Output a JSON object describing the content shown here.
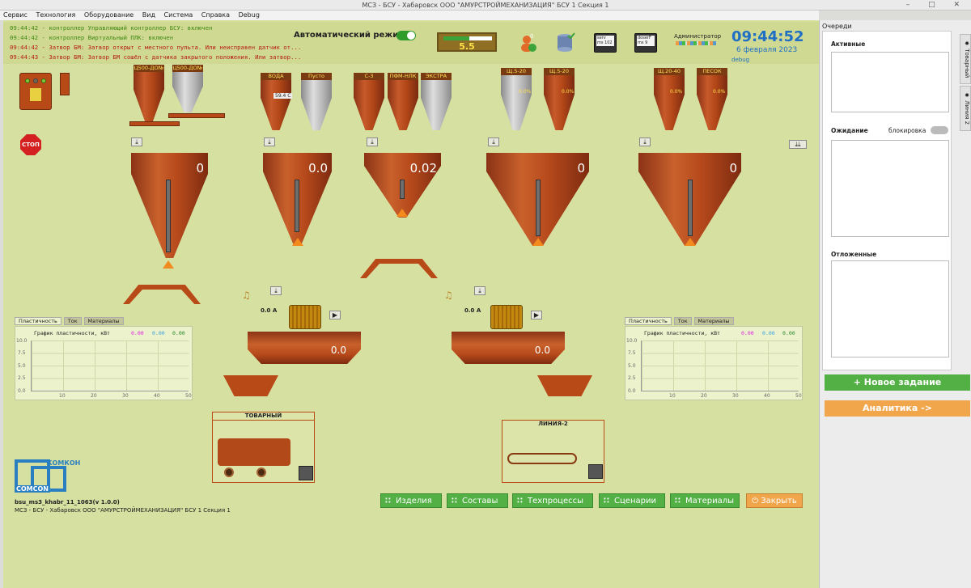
{
  "window": {
    "title": "МСЗ - БСУ - Хабаровск ООО \"АМУРСТРОЙМЕХАНИЗАЦИЯ\" БСУ 1 Секция 1",
    "controls": "–  □  ✕"
  },
  "menu": [
    "Сервис",
    "Технология",
    "Оборудование",
    "Вид",
    "Система",
    "Справка",
    "Debug"
  ],
  "log": [
    {
      "text": "09:44:42 - контроллер Управляющий контроллер БСУ: включен",
      "color": "green"
    },
    {
      "text": "09:44:42 - контроллер Виртуальный ПЛК: включен",
      "color": "green"
    },
    {
      "text": "09:44:42 - Затвор БМ: Затвор открыт с местного пульта. Или неисправен датчик от...",
      "color": "red"
    },
    {
      "text": "09:44:43 - Затвор БМ: Затвор БМ сошёл с датчика закрытого положения. Или затвор...",
      "color": "red"
    }
  ],
  "header": {
    "auto_mode_label": "Автоматический режим",
    "auto_mode_on": true,
    "gauge_value": "5.5",
    "gauge_fill": 0.53,
    "notif_count": "0",
    "serv_label": "serv",
    "serv_ms": "ms 102",
    "doser_label": "doserF",
    "doser_ms": "ms 9",
    "admin_label": "Администратор",
    "time": "09:44:52",
    "date": "6 февраля 2023",
    "debug": "debug"
  },
  "colors": {
    "accent": "#1f6fc4",
    "green_button": "#52b044",
    "orange_button": "#f1a64c",
    "copper": "#b74a1c",
    "background": "#d6e0a1"
  },
  "silos": [
    {
      "label": "Ц500-ДО№",
      "value": ""
    },
    {
      "label": "Ц500-ДО№",
      "value": ""
    },
    {
      "label": "ВОДА",
      "value": "59.4 C"
    },
    {
      "label": "Пусто",
      "value": ""
    },
    {
      "label": "С-3",
      "value": ""
    },
    {
      "label": "ПФМ-НЛК",
      "value": ""
    },
    {
      "label": "ЭКСТРА",
      "value": ""
    },
    {
      "label": "Щ.5-20",
      "value": "0.0%"
    },
    {
      "label": "Щ.5-20",
      "value": "0.0%"
    },
    {
      "label": "Щ.20-40",
      "value": "0.0%"
    },
    {
      "label": "ПЕСОК",
      "value": "0.0%"
    }
  ],
  "dosers": [
    "0",
    "0.0",
    "0.02",
    "0",
    "0"
  ],
  "stop_label": "СТОП",
  "mixers": [
    {
      "current": "0.0 A",
      "value": "0.0"
    },
    {
      "current": "0.0 A",
      "value": "0.0"
    }
  ],
  "charts": [
    {
      "tabs": [
        "Пластичность",
        "Ток",
        "Материалы"
      ],
      "title": "График пластичности, кВт",
      "readings": [
        "0.00",
        "0.00",
        "0.00"
      ],
      "reading_colors": [
        "#e020e0",
        "#3aa0e0",
        "#2a8a2a"
      ],
      "yticks": [
        "10.0",
        "7.5",
        "5.0",
        "2.5",
        "0.0"
      ],
      "xticks": [
        "10",
        "20",
        "30",
        "40",
        "50"
      ]
    },
    {
      "tabs": [
        "Пластичность",
        "Ток",
        "Материалы"
      ],
      "title": "График пластичности, кВт",
      "readings": [
        "0.00",
        "0.00",
        "0.00"
      ],
      "reading_colors": [
        "#e020e0",
        "#3aa0e0",
        "#2a8a2a"
      ],
      "yticks": [
        "10.0",
        "7.5",
        "5.0",
        "2.5",
        "0.0"
      ],
      "xticks": [
        "10",
        "20",
        "30",
        "40",
        "50"
      ]
    }
  ],
  "lines": [
    {
      "label": "ТОВАРНЫЙ"
    },
    {
      "label": "ЛИНИЯ-2"
    }
  ],
  "logo": {
    "top": "КОМКОН",
    "bottom": "COMCON"
  },
  "footer": {
    "version": "bsu_ms3_khabr_11_1063(v 1.0.0)",
    "subtitle": "МСЗ - БСУ - Хабаровск ООО \"АМУРСТРОЙМЕХАНИЗАЦИЯ\" БСУ 1 Секция 1"
  },
  "buttons": [
    "Изделия",
    "Составы",
    "Техпроцессы",
    "Сценарии",
    "Материалы"
  ],
  "close_button": "Закрыть",
  "queue": {
    "title": "Очереди",
    "active": "Активные",
    "waiting": "Ожидание",
    "lock": "блокировка",
    "deferred": "Отложенные",
    "tabs": [
      "Товарный",
      "Линия 2"
    ],
    "new_task": "+ Новое задание",
    "analytics": "Аналитика ->"
  }
}
